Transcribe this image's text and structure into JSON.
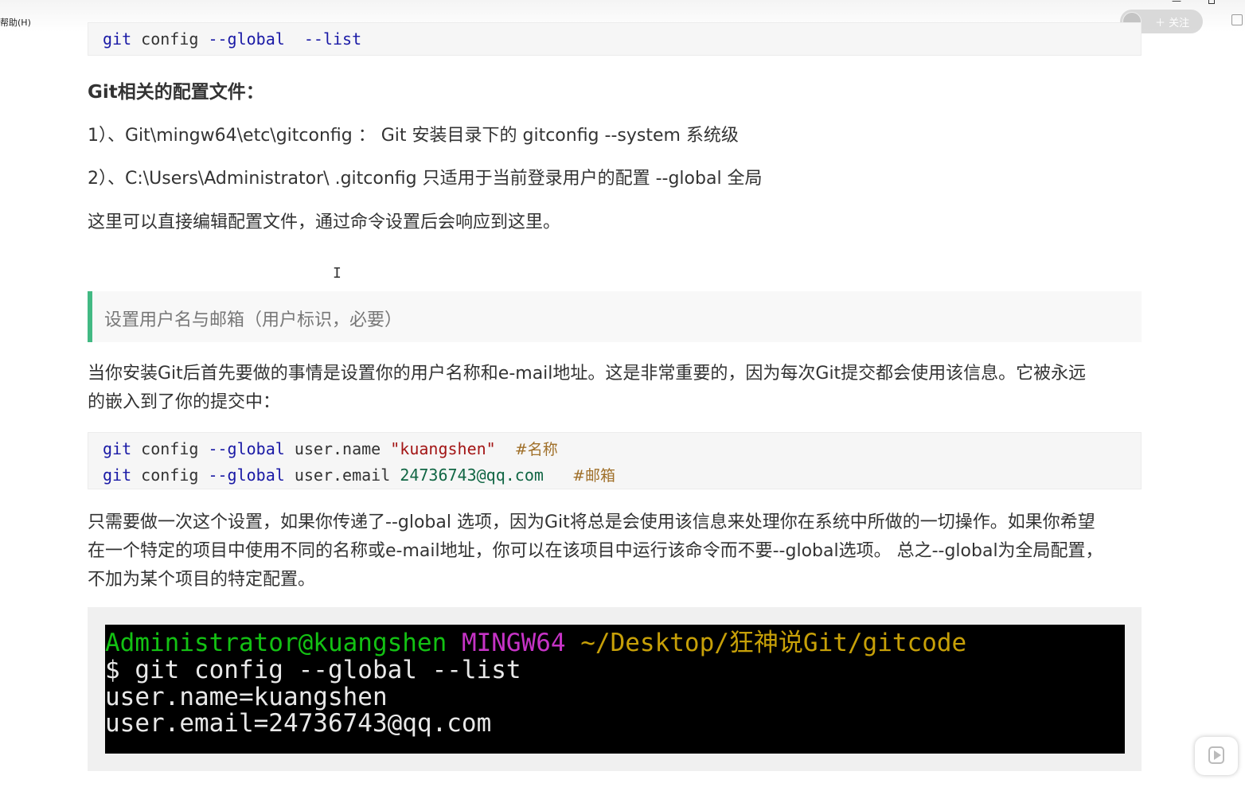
{
  "window": {
    "menu_help": "帮助(H)",
    "minimize_glyph": "—"
  },
  "follow": {
    "label": "＋ 关注"
  },
  "code_block_1": {
    "cmd": "git",
    "sub": "config",
    "flag": "--global",
    "arg": "--list"
  },
  "heading": "Git相关的配置文件：",
  "paragraphs": {
    "p1": "1）、Git\\mingw64\\etc\\gitconfig  ： Git 安装目录下的 gitconfig     --system 系统级",
    "p2": "2）、C:\\Users\\Administrator\\ .gitconfig    只适用于当前登录用户的配置  --global 全局",
    "p3": "这里可以直接编辑配置文件，通过命令设置后会响应到这里。"
  },
  "cursor_glyph": "I",
  "quote": "设置用户名与邮箱（用户标识，必要）",
  "intro": {
    "line1": "当你安装Git后首先要做的事情是设置你的用户名称和e-mail地址。这是非常重要的，因为每次Git提交都会使用该信息。它被永远",
    "line2": "的嵌入到了你的提交中："
  },
  "code_block_2": {
    "line1": {
      "cmd": "git",
      "sub": "config",
      "flag": "--global",
      "key": "user.name",
      "value": "\"kuangshen\"",
      "comment": "#名称"
    },
    "line2": {
      "cmd": "git",
      "sub": "config",
      "flag": "--global",
      "key": "user.email",
      "value": "24736743@qq.com",
      "comment": "#邮箱"
    }
  },
  "note": {
    "line1": "只需要做一次这个设置，如果你传递了--global 选项，因为Git将总是会使用该信息来处理你在系统中所做的一切操作。如果你希望",
    "line2": "在一个特定的项目中使用不同的名称或e-mail地址，你可以在该项目中运行该命令而不要--global选项。 总之--global为全局配置，",
    "line3": "不加为某个项目的特定配置。"
  },
  "terminal": {
    "user": "Administrator@kuangshen",
    "host": "MINGW64",
    "path": "~/Desktop/狂神说Git/gitcode",
    "command": "$ git config --global --list",
    "out1": "user.name=kuangshen",
    "out2": "user.email=24736743@qq.com"
  },
  "colors": {
    "quote_border": "#42b983",
    "terminal_user": "#13c113",
    "terminal_host": "#c633c6",
    "terminal_path": "#c7a008",
    "code_keyword": "#1a1aa6",
    "code_string": "#a31515"
  },
  "icons": [
    "avatar-icon",
    "chat-icon",
    "play-icon",
    "restore-icon"
  ]
}
